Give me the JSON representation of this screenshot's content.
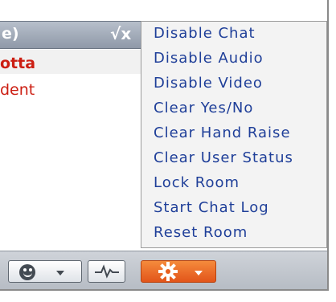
{
  "header": {
    "title_fragment": "e)",
    "check_mark": "√x"
  },
  "user_list": [
    {
      "name_fragment": "otta",
      "color": "#cc1e12"
    },
    {
      "name_fragment": "dent",
      "color": "#cc1e12"
    }
  ],
  "room_menu": {
    "items": [
      {
        "label": "Disable Chat"
      },
      {
        "label": "Disable Audio"
      },
      {
        "label": "Disable Video"
      },
      {
        "label": "Clear Yes/No"
      },
      {
        "label": "Clear Hand Raise"
      },
      {
        "label": "Clear User Status"
      },
      {
        "label": "Lock Room"
      },
      {
        "label": "Start Chat Log"
      },
      {
        "label": "Reset Room"
      }
    ]
  },
  "toolbar": {
    "emoji_icon": "smiley-icon",
    "activity_icon": "activity-icon",
    "gear_icon": "gear-icon",
    "accent_color": "#e8601f"
  }
}
